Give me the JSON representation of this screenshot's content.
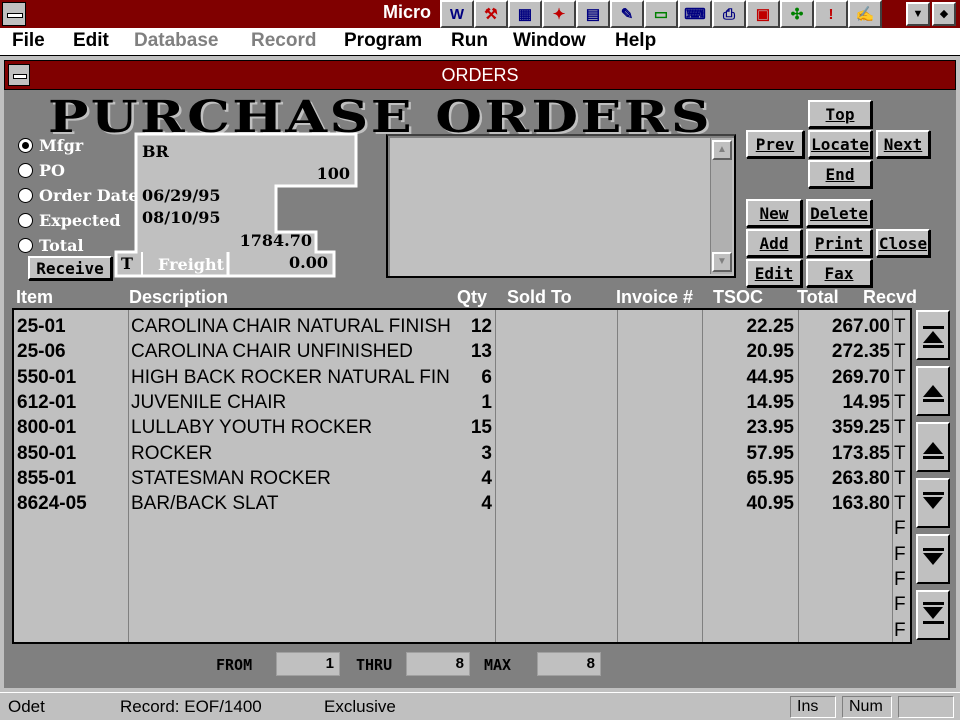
{
  "app": {
    "title": "Micro"
  },
  "toolbar_icons": [
    "w-icon",
    "hammer-icon",
    "charts-icon",
    "fox-icon",
    "report-icon",
    "pen-icon",
    "form-icon",
    "keyboard-icon",
    "printer-icon",
    "ms-icon",
    "puzzle-icon",
    "exclamation-icon",
    "info-icon"
  ],
  "menu": [
    {
      "label": "File",
      "enabled": true
    },
    {
      "label": "Edit",
      "enabled": true
    },
    {
      "label": "Database",
      "enabled": false
    },
    {
      "label": "Record",
      "enabled": false
    },
    {
      "label": "Program",
      "enabled": true
    },
    {
      "label": "Run",
      "enabled": true
    },
    {
      "label": "Window",
      "enabled": true
    },
    {
      "label": "Help",
      "enabled": true
    }
  ],
  "window": {
    "title": "ORDERS"
  },
  "form": {
    "banner": "PURCHASE ORDERS",
    "sort_options": [
      {
        "label": "Mfgr",
        "selected": true
      },
      {
        "label": "PO",
        "selected": false
      },
      {
        "label": "Order Date",
        "selected": false
      },
      {
        "label": "Expected",
        "selected": false
      },
      {
        "label": "Total",
        "selected": false
      }
    ],
    "fields": {
      "mfgr": "BR",
      "po": "100",
      "order_date": "06/29/95",
      "expected": "08/10/95",
      "total": "1784.70",
      "freight_code": "T",
      "freight_label": "Freight",
      "freight": "0.00"
    },
    "receive_button": "Receive",
    "nav_buttons": {
      "top": "Top",
      "prev": "Prev",
      "locate": "Locate",
      "next": "Next",
      "end": "End",
      "new": "New",
      "delete": "Delete",
      "add": "Add",
      "print": "Print",
      "close": "Close",
      "edit": "Edit",
      "fax": "Fax"
    }
  },
  "grid": {
    "columns": [
      "Item",
      "Description",
      "Qty",
      "Sold To",
      "Invoice #",
      "TSOC",
      "Total",
      "Recvd"
    ],
    "rows": [
      {
        "item": "25-01",
        "description": "CAROLINA CHAIR NATURAL FINISH",
        "qty": "12",
        "sold_to": "",
        "invoice": "",
        "tsoc": "22.25",
        "total": "267.00",
        "recvd": "T"
      },
      {
        "item": "25-06",
        "description": "CAROLINA CHAIR UNFINISHED",
        "qty": "13",
        "sold_to": "",
        "invoice": "",
        "tsoc": "20.95",
        "total": "272.35",
        "recvd": "T"
      },
      {
        "item": "550-01",
        "description": "HIGH BACK ROCKER NATURAL FIN",
        "qty": "6",
        "sold_to": "",
        "invoice": "",
        "tsoc": "44.95",
        "total": "269.70",
        "recvd": "T"
      },
      {
        "item": "612-01",
        "description": "JUVENILE CHAIR",
        "qty": "1",
        "sold_to": "",
        "invoice": "",
        "tsoc": "14.95",
        "total": "14.95",
        "recvd": "T"
      },
      {
        "item": "800-01",
        "description": "LULLABY YOUTH ROCKER",
        "qty": "15",
        "sold_to": "",
        "invoice": "",
        "tsoc": "23.95",
        "total": "359.25",
        "recvd": "T"
      },
      {
        "item": "850-01",
        "description": "ROCKER",
        "qty": "3",
        "sold_to": "",
        "invoice": "",
        "tsoc": "57.95",
        "total": "173.85",
        "recvd": "T"
      },
      {
        "item": "855-01",
        "description": "STATESMAN ROCKER",
        "qty": "4",
        "sold_to": "",
        "invoice": "",
        "tsoc": "65.95",
        "total": "263.80",
        "recvd": "T"
      },
      {
        "item": "8624-05",
        "description": "BAR/BACK SLAT",
        "qty": "4",
        "sold_to": "",
        "invoice": "",
        "tsoc": "40.95",
        "total": "163.80",
        "recvd": "T"
      },
      {
        "item": "",
        "description": "",
        "qty": "",
        "sold_to": "",
        "invoice": "",
        "tsoc": "",
        "total": "",
        "recvd": "F"
      },
      {
        "item": "",
        "description": "",
        "qty": "",
        "sold_to": "",
        "invoice": "",
        "tsoc": "",
        "total": "",
        "recvd": "F"
      },
      {
        "item": "",
        "description": "",
        "qty": "",
        "sold_to": "",
        "invoice": "",
        "tsoc": "",
        "total": "",
        "recvd": "F"
      },
      {
        "item": "",
        "description": "",
        "qty": "",
        "sold_to": "",
        "invoice": "",
        "tsoc": "",
        "total": "",
        "recvd": "F"
      },
      {
        "item": "",
        "description": "",
        "qty": "",
        "sold_to": "",
        "invoice": "",
        "tsoc": "",
        "total": "",
        "recvd": "F"
      }
    ]
  },
  "footer": {
    "from_label": "FROM",
    "from_value": "1",
    "thru_label": "THRU",
    "thru_value": "8",
    "max_label": "MAX",
    "max_value": "8"
  },
  "status": {
    "table": "Odet",
    "record": "Record: EOF/1400",
    "mode": "Exclusive",
    "ins": "Ins",
    "num": "Num"
  }
}
